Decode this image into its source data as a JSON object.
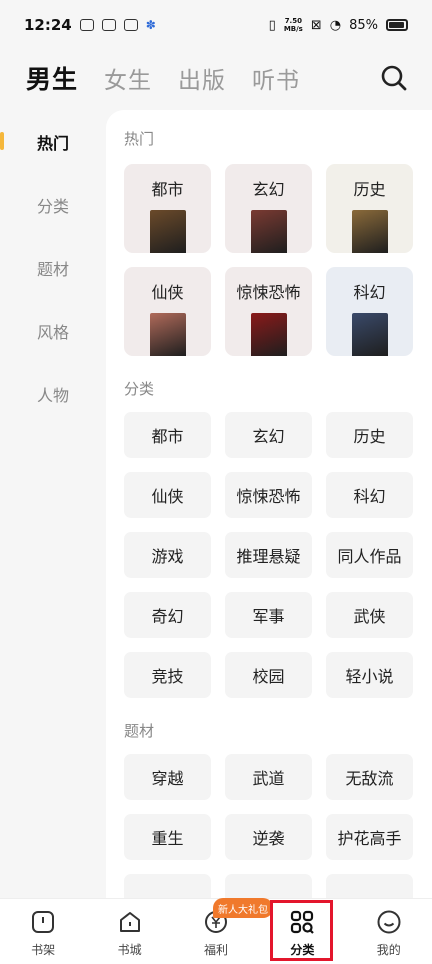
{
  "status": {
    "time": "12:24",
    "net_speed_value": "7.50",
    "net_speed_unit": "MB/s",
    "battery": "85%"
  },
  "top_tabs": [
    "男生",
    "女生",
    "出版",
    "听书"
  ],
  "left_nav": [
    "热门",
    "分类",
    "题材",
    "风格",
    "人物"
  ],
  "sections": {
    "hot_title": "热门",
    "hot_items": [
      {
        "label": "都市",
        "cover": "#6b4a2a",
        "bg": "#f1ebeb"
      },
      {
        "label": "玄幻",
        "cover": "#7a3a32",
        "bg": "#f1ebeb"
      },
      {
        "label": "历史",
        "cover": "#8a6a3a",
        "bg": "#f2f0ea"
      },
      {
        "label": "仙侠",
        "cover": "#b06a5a",
        "bg": "#f1ebeb"
      },
      {
        "label": "惊悚恐怖",
        "cover": "#8a1a1a",
        "bg": "#f1ebeb"
      },
      {
        "label": "科幻",
        "cover": "#3a4a6a",
        "bg": "#e9edf3"
      }
    ],
    "category_title": "分类",
    "category_items": [
      "都市",
      "玄幻",
      "历史",
      "仙侠",
      "惊悚恐怖",
      "科幻",
      "游戏",
      "推理悬疑",
      "同人作品",
      "奇幻",
      "军事",
      "武侠",
      "竞技",
      "校园",
      "轻小说"
    ],
    "theme_title": "题材",
    "theme_items": [
      "穿越",
      "武道",
      "无敌流",
      "重生",
      "逆袭",
      "护花高手"
    ]
  },
  "tab_bar": {
    "items": [
      {
        "label": "书架",
        "icon": "bookshelf-icon"
      },
      {
        "label": "书城",
        "icon": "bookstore-icon"
      },
      {
        "label": "福利",
        "icon": "welfare-icon"
      },
      {
        "label": "分类",
        "icon": "category-icon"
      },
      {
        "label": "我的",
        "icon": "profile-icon"
      }
    ],
    "gift_badge": "新人大礼包"
  },
  "colors": {
    "accent": "#f5b73b",
    "highlight": "#e3162c",
    "badge": "#f0792c"
  }
}
